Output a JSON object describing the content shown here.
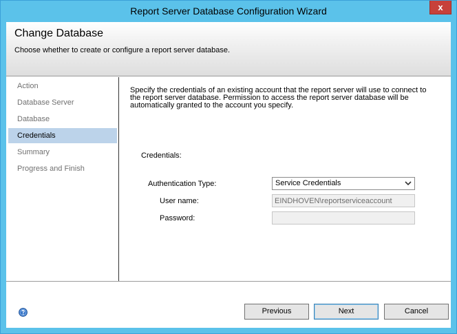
{
  "window": {
    "title": "Report Server Database Configuration Wizard",
    "close_glyph": "x"
  },
  "header": {
    "title": "Change Database",
    "subtitle": "Choose whether to create or configure a report server database."
  },
  "nav": {
    "items": [
      {
        "label": "Action",
        "active": false
      },
      {
        "label": "Database Server",
        "active": false
      },
      {
        "label": "Database",
        "active": false
      },
      {
        "label": "Credentials",
        "active": true
      },
      {
        "label": "Summary",
        "active": false
      },
      {
        "label": "Progress and Finish",
        "active": false
      }
    ]
  },
  "content": {
    "description": "Specify the credentials of an existing account that the report server will use to connect to the report server database.  Permission to access the report server database will be automatically granted to the account you specify.",
    "section_label": "Credentials:",
    "auth_type_label": "Authentication Type:",
    "auth_type_value": "Service Credentials",
    "username_label": "User name:",
    "username_value": "EINDHOVEN\\reportserviceaccount",
    "password_label": "Password:",
    "password_value": ""
  },
  "buttons": {
    "previous_label": "Previous",
    "next_label": "Next",
    "cancel_label": "Cancel"
  },
  "icons": {
    "help": "help-icon",
    "dropdown": "chevron-down-icon",
    "close": "close-icon"
  },
  "colors": {
    "titlebar": "#5bc2ea",
    "close": "#c7413a",
    "nav_selected": "#bcd3ea"
  }
}
